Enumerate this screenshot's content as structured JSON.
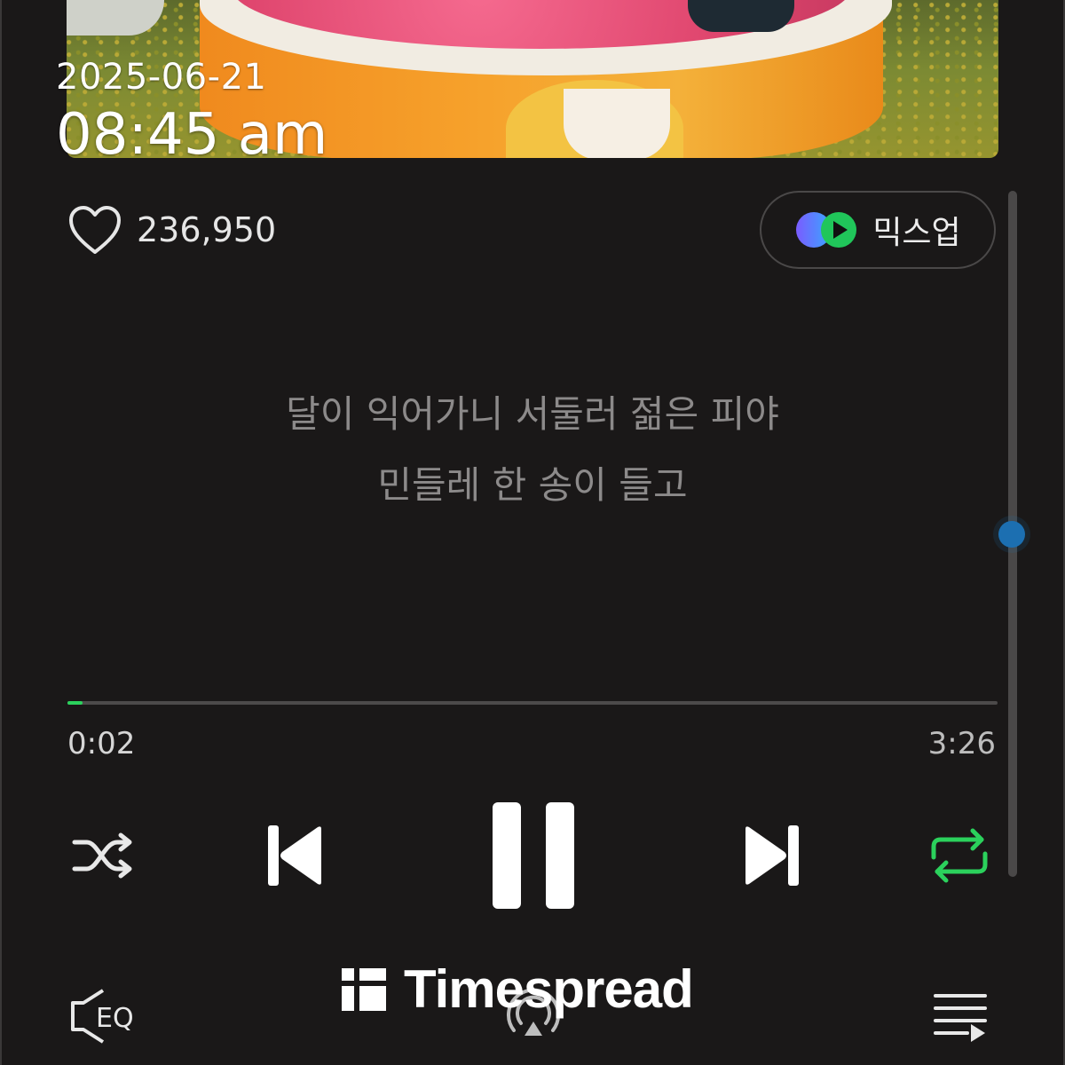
{
  "status": {
    "date": "2025-06-21",
    "time": "08:45 am"
  },
  "player": {
    "likes": "236,950",
    "mixup_label": "믹스업",
    "lyrics": [
      "달이 익어가니 서둘러 젊은 피야",
      "민들레 한 송이 들고"
    ],
    "elapsed": "0:02",
    "duration": "3:26",
    "progress_fraction": 0.016,
    "repeat_active": true,
    "eq_label": "EQ"
  },
  "watermark": {
    "text": "Timespread"
  },
  "colors": {
    "accent": "#2bd15c",
    "scroll_thumb": "#1c6fb1",
    "background": "#1a1818"
  },
  "icons": [
    "heart-icon",
    "mixup-icon",
    "shuffle-icon",
    "previous-icon",
    "pause-icon",
    "next-icon",
    "repeat-icon",
    "eq-icon",
    "cast-icon",
    "playlist-icon"
  ]
}
